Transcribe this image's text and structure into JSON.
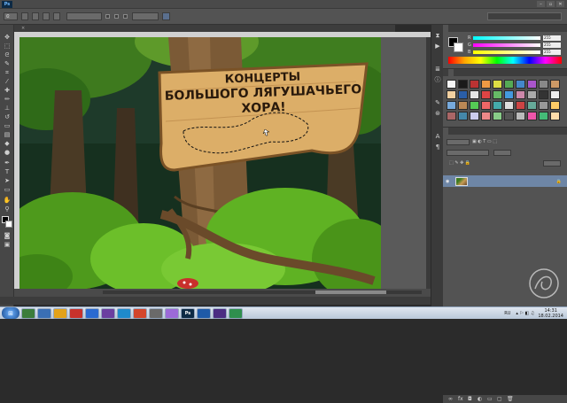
{
  "app": {
    "logo": "Ps"
  },
  "menu": {
    "items": [
      "",
      "",
      "",
      "",
      "",
      "",
      "",
      "",
      "",
      "",
      ""
    ]
  },
  "window_controls": [
    "–",
    "▫",
    "✕"
  ],
  "options_bar": {
    "mode_label": "",
    "mode_value": "",
    "opt1": "",
    "opt2": "",
    "opt3": "",
    "button": "",
    "workspace": ""
  },
  "document": {
    "tab_title": "",
    "close": "×",
    "zoom": "",
    "status": ""
  },
  "mini_bridge": {
    "label": ""
  },
  "color_panel": {
    "tabs": [
      "",
      ""
    ],
    "channels": [
      {
        "label": "R",
        "value": "255"
      },
      {
        "label": "G",
        "value": "255"
      },
      {
        "label": "B",
        "value": "255"
      }
    ]
  },
  "styles_panel": {
    "tabs": [
      "",
      ""
    ]
  },
  "layers_panel": {
    "tabs": [
      "",
      "",
      ""
    ],
    "kind": "",
    "blend_mode": "",
    "opacity_label": "",
    "opacity_value": "",
    "fill_label": "",
    "fill_value": "",
    "lock_label": "",
    "layer": {
      "name": "",
      "visible": "◉",
      "lock": "🔒"
    }
  },
  "sign": {
    "line1": "КОНЦЕРТЫ",
    "line2": "БОЛЬШОГО ЛЯГУШАЧЬЕГО",
    "line3": "ХОРА!"
  },
  "taskbar": {
    "lang": "RU",
    "time": "14:31",
    "date": "18.02.2014",
    "apps": [
      "",
      "",
      "",
      "",
      "",
      "",
      "",
      "",
      "",
      "",
      "Ps",
      "",
      "",
      ""
    ]
  },
  "colors": {
    "accent": "#6e86a6",
    "canvas_bg": "#1e3a2a"
  }
}
